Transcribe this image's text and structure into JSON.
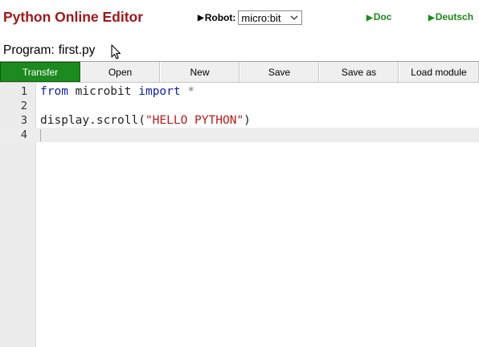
{
  "header": {
    "title": "Python Online Editor",
    "robot_label": "Robot:",
    "robot_value": "micro:bit",
    "doc_link": "Doc",
    "lang_link": "Deutsch"
  },
  "program": {
    "label": "Program:",
    "filename": "first.py"
  },
  "toolbar": {
    "transfer": "Transfer",
    "open": "Open",
    "new": "New",
    "save": "Save",
    "save_as": "Save as",
    "load_module": "Load module"
  },
  "editor": {
    "lines": [
      {
        "num": "1",
        "parts": [
          [
            "kw",
            "from"
          ],
          [
            "",
            "microbit"
          ],
          [
            "kw",
            "import"
          ],
          [
            "op",
            "*"
          ]
        ]
      },
      {
        "num": "2"
      },
      {
        "num": "3",
        "parts": [
          [
            "",
            "display.scroll("
          ],
          [
            "str",
            "\"HELLO PYTHON\""
          ],
          [
            "",
            ")"
          ]
        ]
      },
      {
        "num": "4"
      }
    ],
    "line1": {
      "kw1": "from",
      "mod": " microbit ",
      "kw2": "import",
      "star": " *"
    },
    "line3": {
      "fn": "display.scroll(",
      "str": "\"HELLO PYTHON\"",
      "close": ")"
    },
    "active_line": 4
  },
  "colors": {
    "title": "#a0181d",
    "link": "#1a8a1a",
    "transfer_bg": "#1c8a1e",
    "keyword": "#1020b0",
    "string": "#c01818"
  },
  "icons": [
    "dropdown-chevron-icon",
    "mouse-pointer-icon",
    "triangle-bullet-icon"
  ]
}
